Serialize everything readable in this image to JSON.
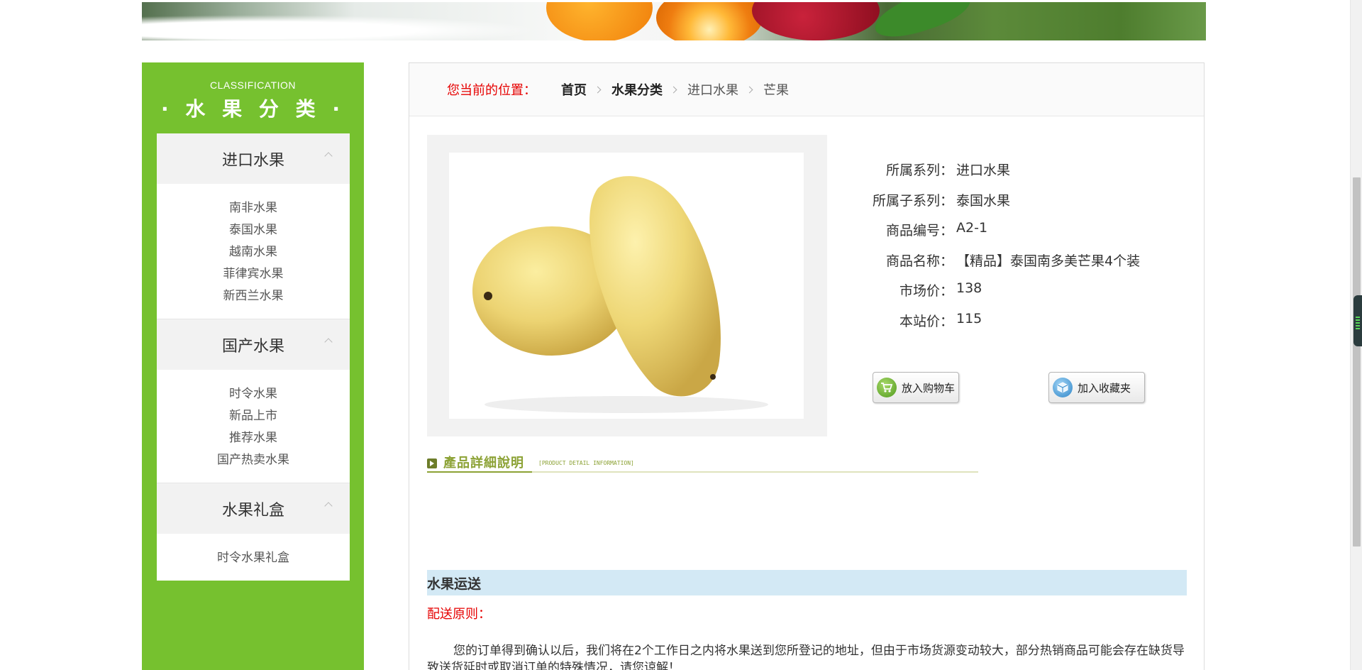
{
  "sidebar": {
    "title_en": "CLASSIFICATION",
    "title_cn": "· 水 果 分 类 ·",
    "categories": [
      {
        "label": "进口水果",
        "items": [
          "南非水果",
          "泰国水果",
          "越南水果",
          "菲律宾水果",
          "新西兰水果"
        ]
      },
      {
        "label": "国产水果",
        "items": [
          "时令水果",
          "新品上市",
          "推荐水果",
          "国产热卖水果"
        ]
      },
      {
        "label": "水果礼盒",
        "items": [
          "时令水果礼盒"
        ]
      }
    ]
  },
  "breadcrumb": {
    "label": "您当前的位置：",
    "home": "首页",
    "category": "水果分类",
    "subcategory": "进口水果",
    "current": "芒果"
  },
  "product": {
    "fields": [
      {
        "key": "所属系列：",
        "value": "进口水果"
      },
      {
        "key": "所属子系列：",
        "value": "泰国水果"
      },
      {
        "key": "商品编号：",
        "value": "A2-1"
      },
      {
        "key": "商品名称：",
        "value": "【精品】泰国南多美芒果4个装"
      },
      {
        "key": "市场价：",
        "value": "138"
      },
      {
        "key": "本站价：",
        "value": "115"
      }
    ],
    "add_cart_label": "放入购物车",
    "add_fav_label": "加入收藏夹"
  },
  "detail": {
    "title_cn": "產品詳細說明",
    "title_en": "[PRODUCT DETAIL INFORMATION]"
  },
  "shipping": {
    "title": "水果运送",
    "subtitle": "配送原则：",
    "text": "您的订单得到确认以后，我们将在2个工作日之内将水果送到您所登记的地址，但由于市场货源变动较大，部分热销商品可能会存在缺货导致送货延时或取消订单的特殊情况，请您谅解！"
  },
  "colors": {
    "sidebar_green": "#76c12f",
    "accent_red": "#e60000",
    "detail_olive": "#8ca235",
    "shipping_blue": "#d3e9f5"
  }
}
